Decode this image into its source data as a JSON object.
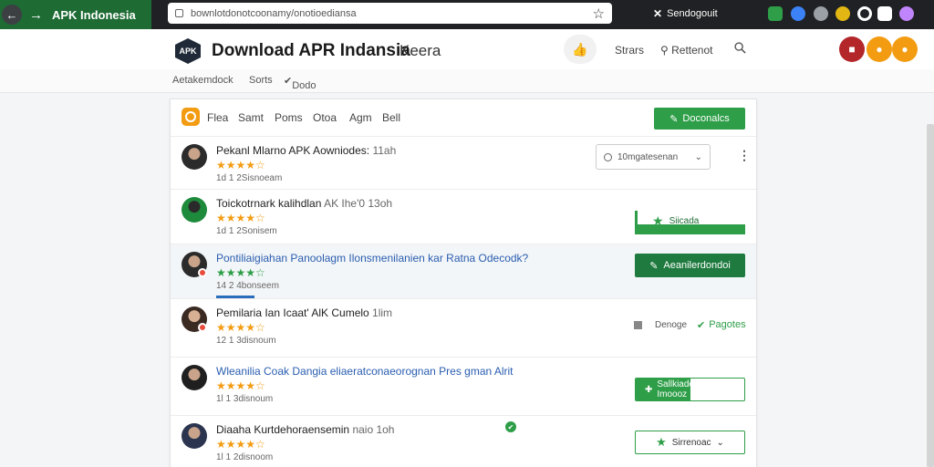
{
  "browser": {
    "tab_title": "APK Indonesia",
    "url": "bownlotdonotcoonamy/onotioediansa",
    "action_label": "Sendogouit",
    "extension_colors": [
      "#2e9e48",
      "#3b82f6",
      "#9aa0a6",
      "#e2b714",
      "#ffffff",
      "#ffffff",
      "#c084fc"
    ]
  },
  "header": {
    "logo_text": "APK",
    "title": "Download APR Indansia",
    "subtitle": "Keera",
    "link_stars": "Strars",
    "link_referral": "Rettenot",
    "accent_colors": {
      "red": "#c0392b",
      "orange": "#f39c12"
    }
  },
  "subnav": {
    "items": [
      "Aetakemdock",
      "Sorts",
      "Dodo"
    ]
  },
  "filters": {
    "tabs": [
      "Flea",
      "Samt",
      "Poms",
      "Otoa",
      "Agm",
      "Bell"
    ],
    "download_label": "Doconalcs"
  },
  "rows": [
    {
      "title": "Pekanl Mlarno APK Aowniodes:",
      "meta": "11ah",
      "stars": "★★★★☆",
      "sub": "1d 1 2Sisnoeam",
      "select_label": "10mgatesenan",
      "link": false
    },
    {
      "title": "Toickotrnark kalihdlan",
      "meta": "AK Ihe'0 13oh",
      "stars": "★★★★☆",
      "sub": "1d 1 2Sonisem",
      "action_label": "Siicada",
      "link": false
    },
    {
      "title": "Pontiliaigiahan Panoolagm Ilonsmenilanien kar Ratna Odecodk?",
      "meta": "",
      "stars": "★★★★☆",
      "sub": "14 2 4bonseem",
      "action_label": "Aeanilerdondoi",
      "link": true
    },
    {
      "title": "Pemilaria Ian Icaat' AlK Cumelo",
      "meta": "1lim",
      "stars": "★★★★☆",
      "sub": "12 1 3disnoum",
      "mini_label": "Denoge",
      "check_label": "Pagotes",
      "link": false
    },
    {
      "title": "Wleanilia Coak Dangia eliaeratconaeorognan Pres gman Alrit",
      "meta": "",
      "stars": "★★★★☆",
      "sub": "1l 1 3disnoum",
      "action_label": "Sallkiade Imoooz",
      "link": true
    },
    {
      "title": "Diaaha Kurtdehoraensemin",
      "meta": "naio 1oh",
      "stars": "★★★★☆",
      "sub": "1l 1 2disnoom",
      "action_label": "Sirrenoac",
      "link": false
    }
  ]
}
